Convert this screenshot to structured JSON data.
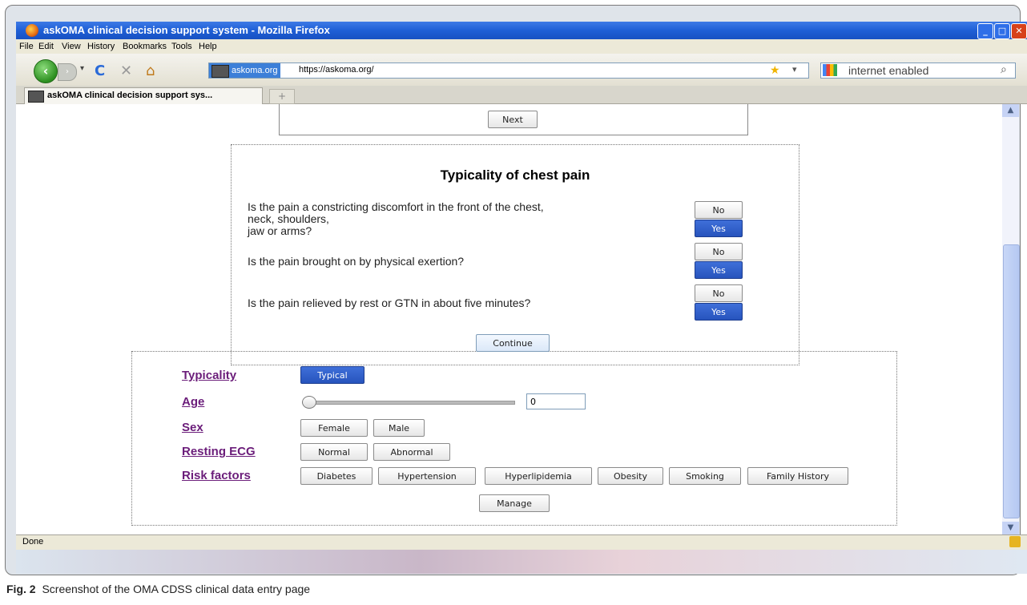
{
  "window": {
    "title": "askOMA clinical decision support system - Mozilla Firefox"
  },
  "menu": [
    "File",
    "Edit",
    "View",
    "History",
    "Bookmarks",
    "Tools",
    "Help"
  ],
  "navbar": {
    "site_badge": "askoma.org",
    "url": "https://askoma.org/",
    "search_placeholder": "internet enabled"
  },
  "tab": {
    "title": "askOMA clinical decision support sys...",
    "new_tab": "+"
  },
  "page": {
    "next_button": "Next",
    "chest": {
      "title": "Typicality of chest pain",
      "questions": [
        {
          "text_lines": [
            "Is the pain a constricting discomfort in the front of the chest,",
            "neck, shoulders,",
            "jaw or arms?"
          ],
          "no": "No",
          "yes": "Yes",
          "selected": "Yes"
        },
        {
          "text_lines": [
            "Is the pain brought on by physical exertion?"
          ],
          "no": "No",
          "yes": "Yes",
          "selected": "Yes"
        },
        {
          "text_lines": [
            "Is the pain relieved by rest or GTN in about five minutes?"
          ],
          "no": "No",
          "yes": "Yes",
          "selected": "Yes"
        }
      ],
      "continue_button": "Continue"
    },
    "summary": {
      "typicality": {
        "label": "Typicality",
        "value": "Typical"
      },
      "age": {
        "label": "Age",
        "value": "0",
        "slider_level": 0
      },
      "sex": {
        "label": "Sex",
        "options": [
          "Female",
          "Male"
        ]
      },
      "ecg": {
        "label": "Resting ECG",
        "options": [
          "Normal",
          "Abnormal"
        ]
      },
      "risk": {
        "label": "Risk factors",
        "options": [
          "Diabetes",
          "Hypertension",
          "Hyperlipidemia",
          "Obesity",
          "Smoking",
          "Family History"
        ]
      },
      "manage_button": "Manage"
    }
  },
  "status": "Done",
  "caption": {
    "bold": "Fig. 2",
    "text": "Screenshot of the OMA CDSS clinical data entry page"
  }
}
